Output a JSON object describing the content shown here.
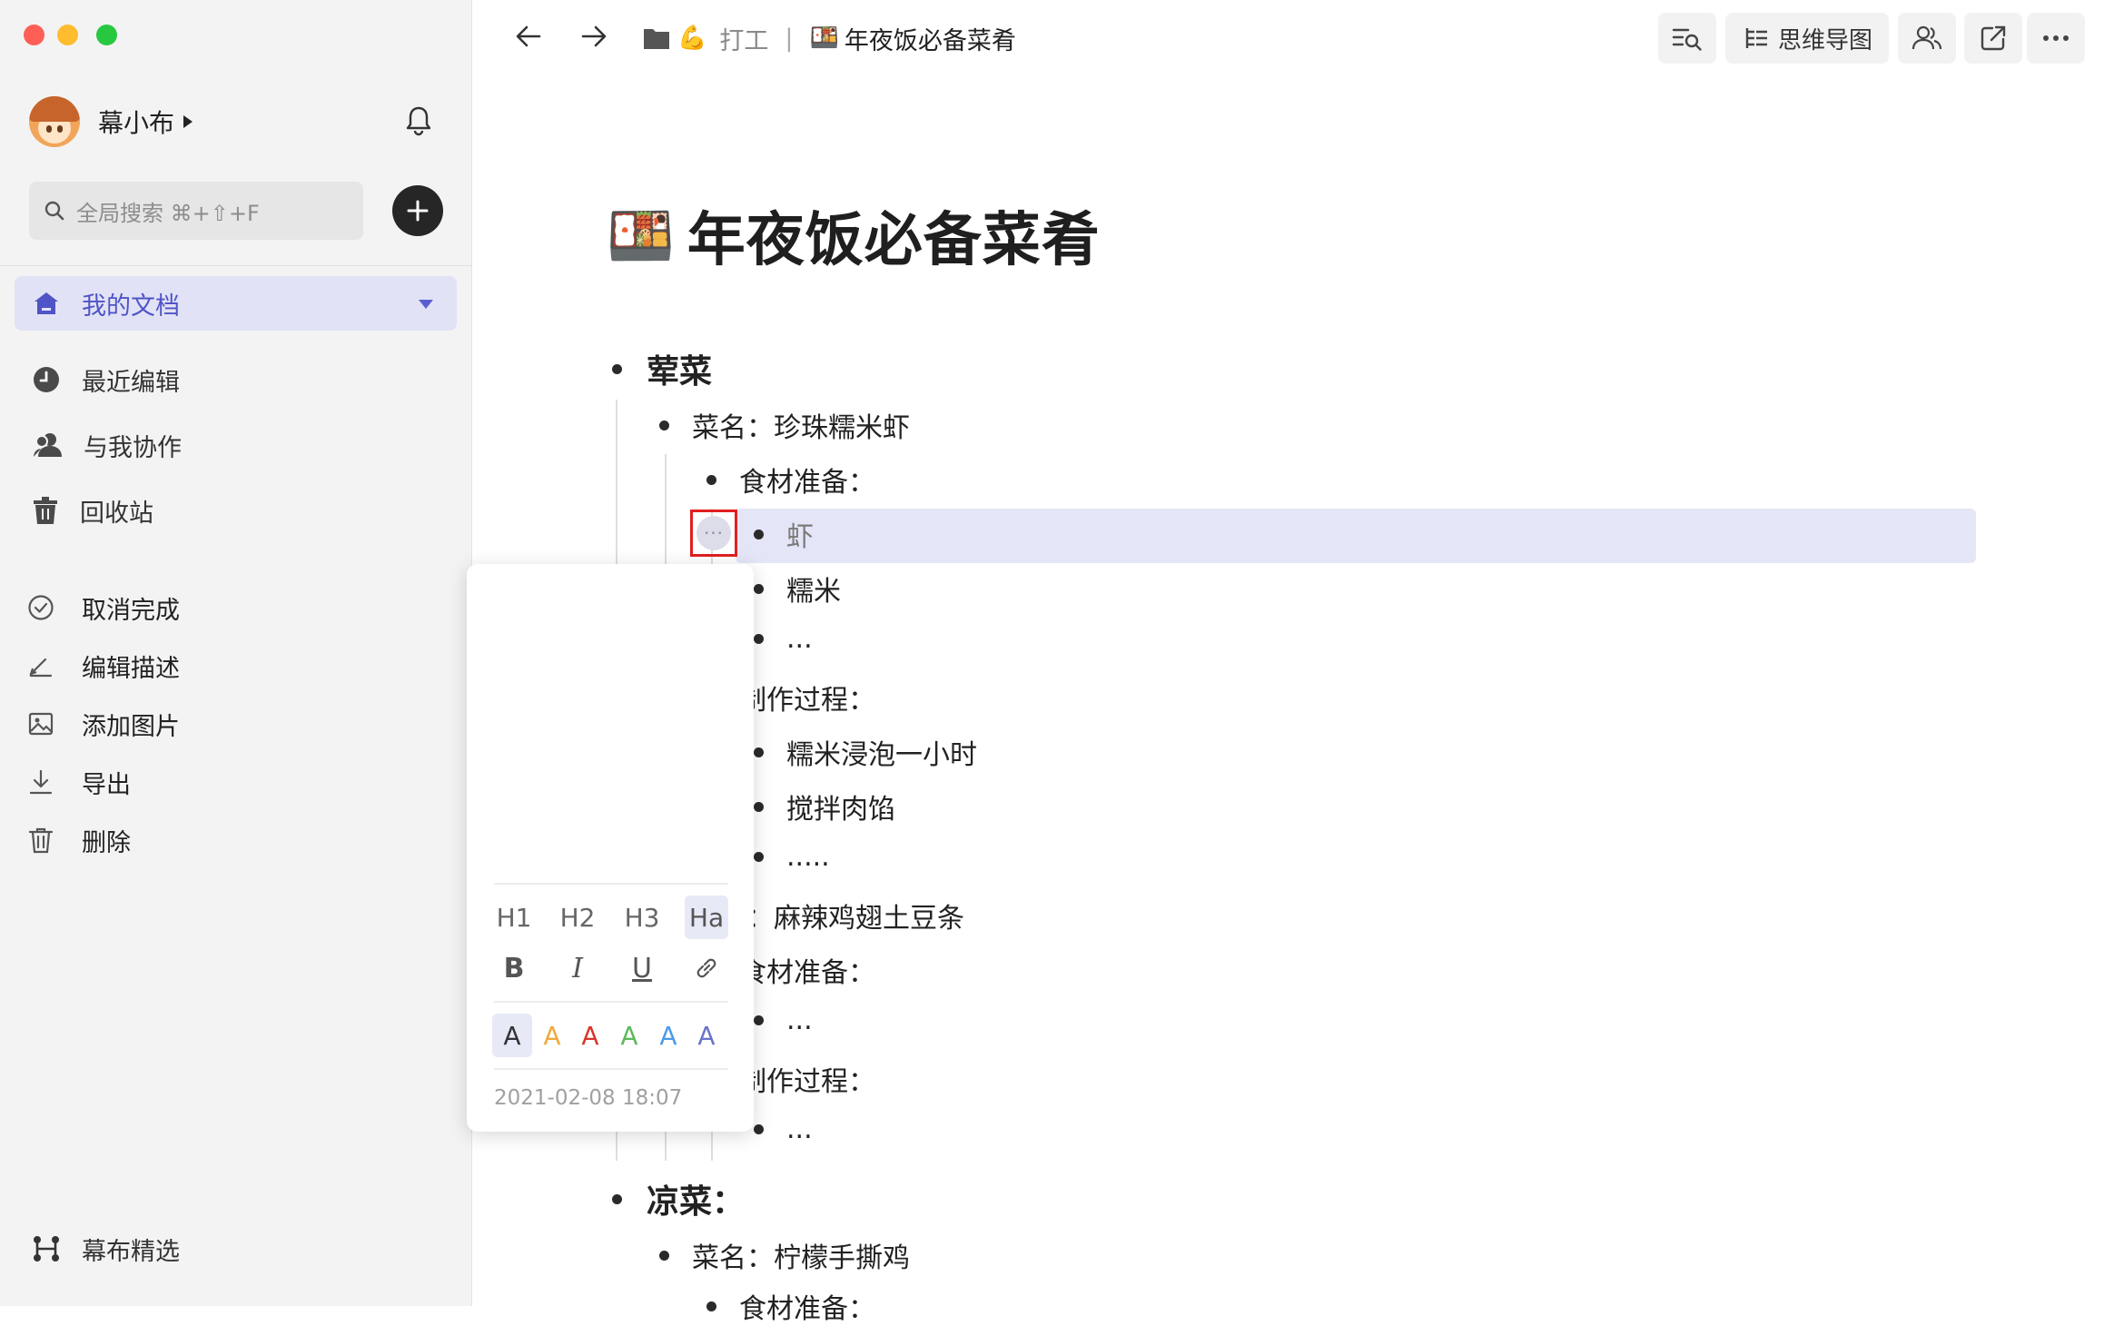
{
  "app": {
    "user_name": "幕小布",
    "search_placeholder": "全局搜索 ⌘+⇧+F"
  },
  "sidebar": {
    "my_docs": "我的文档",
    "recent": "最近编辑",
    "collab": "与我协作",
    "trash": "回收站",
    "featured": "幕布精选"
  },
  "topbar": {
    "breadcrumb_parent": "打工",
    "breadcrumb_current": "年夜饭必备菜肴",
    "mindmap_label": "思维导图"
  },
  "document": {
    "title": "年夜饭必备菜肴",
    "title_emoji": "🍱",
    "nodes": {
      "n1": "荤菜",
      "n2": "菜名：珍珠糯米虾",
      "n3": "食材准备：",
      "n4": "虾",
      "n5": "糯米",
      "n6": "...",
      "n7": "制作过程：",
      "n8": "糯米浸泡一小时",
      "n9": "搅拌肉馅",
      "n10": ".....",
      "n11": "菜名：麻辣鸡翅土豆条",
      "n12": "食材准备：",
      "n13": "...",
      "n14": "制作过程：",
      "n15": "...",
      "n16": "凉菜：",
      "n17": "菜名：柠檬手撕鸡",
      "n18": "食材准备："
    }
  },
  "context_menu": {
    "undone": "取消完成",
    "edit_desc": "编辑描述",
    "add_image": "添加图片",
    "export": "导出",
    "delete": "删除",
    "heading_options": [
      "H1",
      "H2",
      "H3",
      "Ha"
    ],
    "format_options": [
      "B",
      "I",
      "U"
    ],
    "color_letter": "A",
    "colors": [
      "#333333",
      "#f0a93b",
      "#d8352a",
      "#5cb85c",
      "#4a9be6",
      "#6a72c9"
    ],
    "timestamp": "2021-02-08 18:07"
  }
}
